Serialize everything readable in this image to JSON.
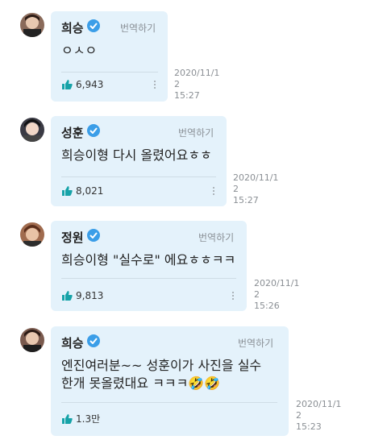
{
  "messages": [
    {
      "name": "희승",
      "translate": "번역하기",
      "text": "ㅇㅅㅇ",
      "likes": "6,943",
      "timestamp": "2020/11/1\n2\n15:27",
      "avatar_color": "#8a6a5a"
    },
    {
      "name": "성훈",
      "translate": "번역하기",
      "text": "희승이형 다시 올렸어요ㅎㅎ",
      "likes": "8,021",
      "timestamp": "2020/11/1\n2\n15:27",
      "avatar_color": "#3a3a44"
    },
    {
      "name": "정원",
      "translate": "번역하기",
      "text": "희승이형 \"실수로\" 에요ㅎㅎㅋㅋ",
      "likes": "9,813",
      "timestamp": "2020/11/1\n2\n15:26",
      "avatar_color": "#a06b4e"
    },
    {
      "name": "희승",
      "translate": "번역하기",
      "text": "엔진여러분~~ 성훈이가 사진을 실수\n한개 못올렸대요 ㅋㅋㅋ🤣🤣",
      "likes": "1.3만",
      "timestamp": "2020/11/1\n2\n15:23",
      "avatar_color": "#7a5a4e"
    }
  ],
  "colors": {
    "bubble": "#e4f2fb",
    "verified": "#3b9ee8",
    "like": "#16a3a8"
  }
}
